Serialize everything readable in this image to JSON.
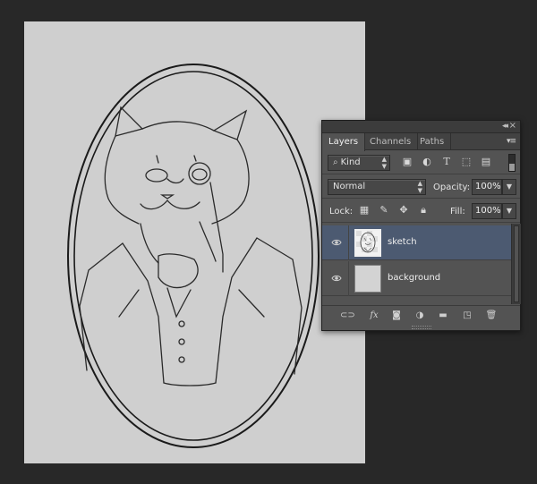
{
  "panel": {
    "tabs": [
      {
        "label": "Layers",
        "active": true
      },
      {
        "label": "Channels",
        "active": false
      },
      {
        "label": "Paths",
        "active": false
      }
    ],
    "filter": {
      "kind_label": "Kind"
    },
    "blend": {
      "mode": "Normal",
      "opacity_label": "Opacity:",
      "opacity_value": "100%"
    },
    "lock": {
      "lock_label": "Lock:",
      "fill_label": "Fill:",
      "fill_value": "100%"
    },
    "layers": [
      {
        "name": "sketch",
        "visible": true,
        "selected": true
      },
      {
        "name": "background",
        "visible": true,
        "selected": false
      }
    ]
  },
  "colors": {
    "workspace": "#282828",
    "document": "#cfcfcf",
    "panel_bg": "#535353",
    "selected_layer": "#4c5a71"
  },
  "icons": {
    "filter": [
      "image-filter-icon",
      "adjustment-filter-icon",
      "type-filter-icon",
      "shape-filter-icon",
      "smart-object-filter-icon"
    ],
    "lock": [
      "lock-transparent-icon",
      "lock-image-icon",
      "lock-position-icon",
      "lock-all-icon"
    ],
    "bottom": [
      "link-layers-icon",
      "layer-style-icon",
      "layer-mask-icon",
      "adjustment-layer-icon",
      "new-group-icon",
      "new-layer-icon",
      "delete-layer-icon"
    ]
  }
}
